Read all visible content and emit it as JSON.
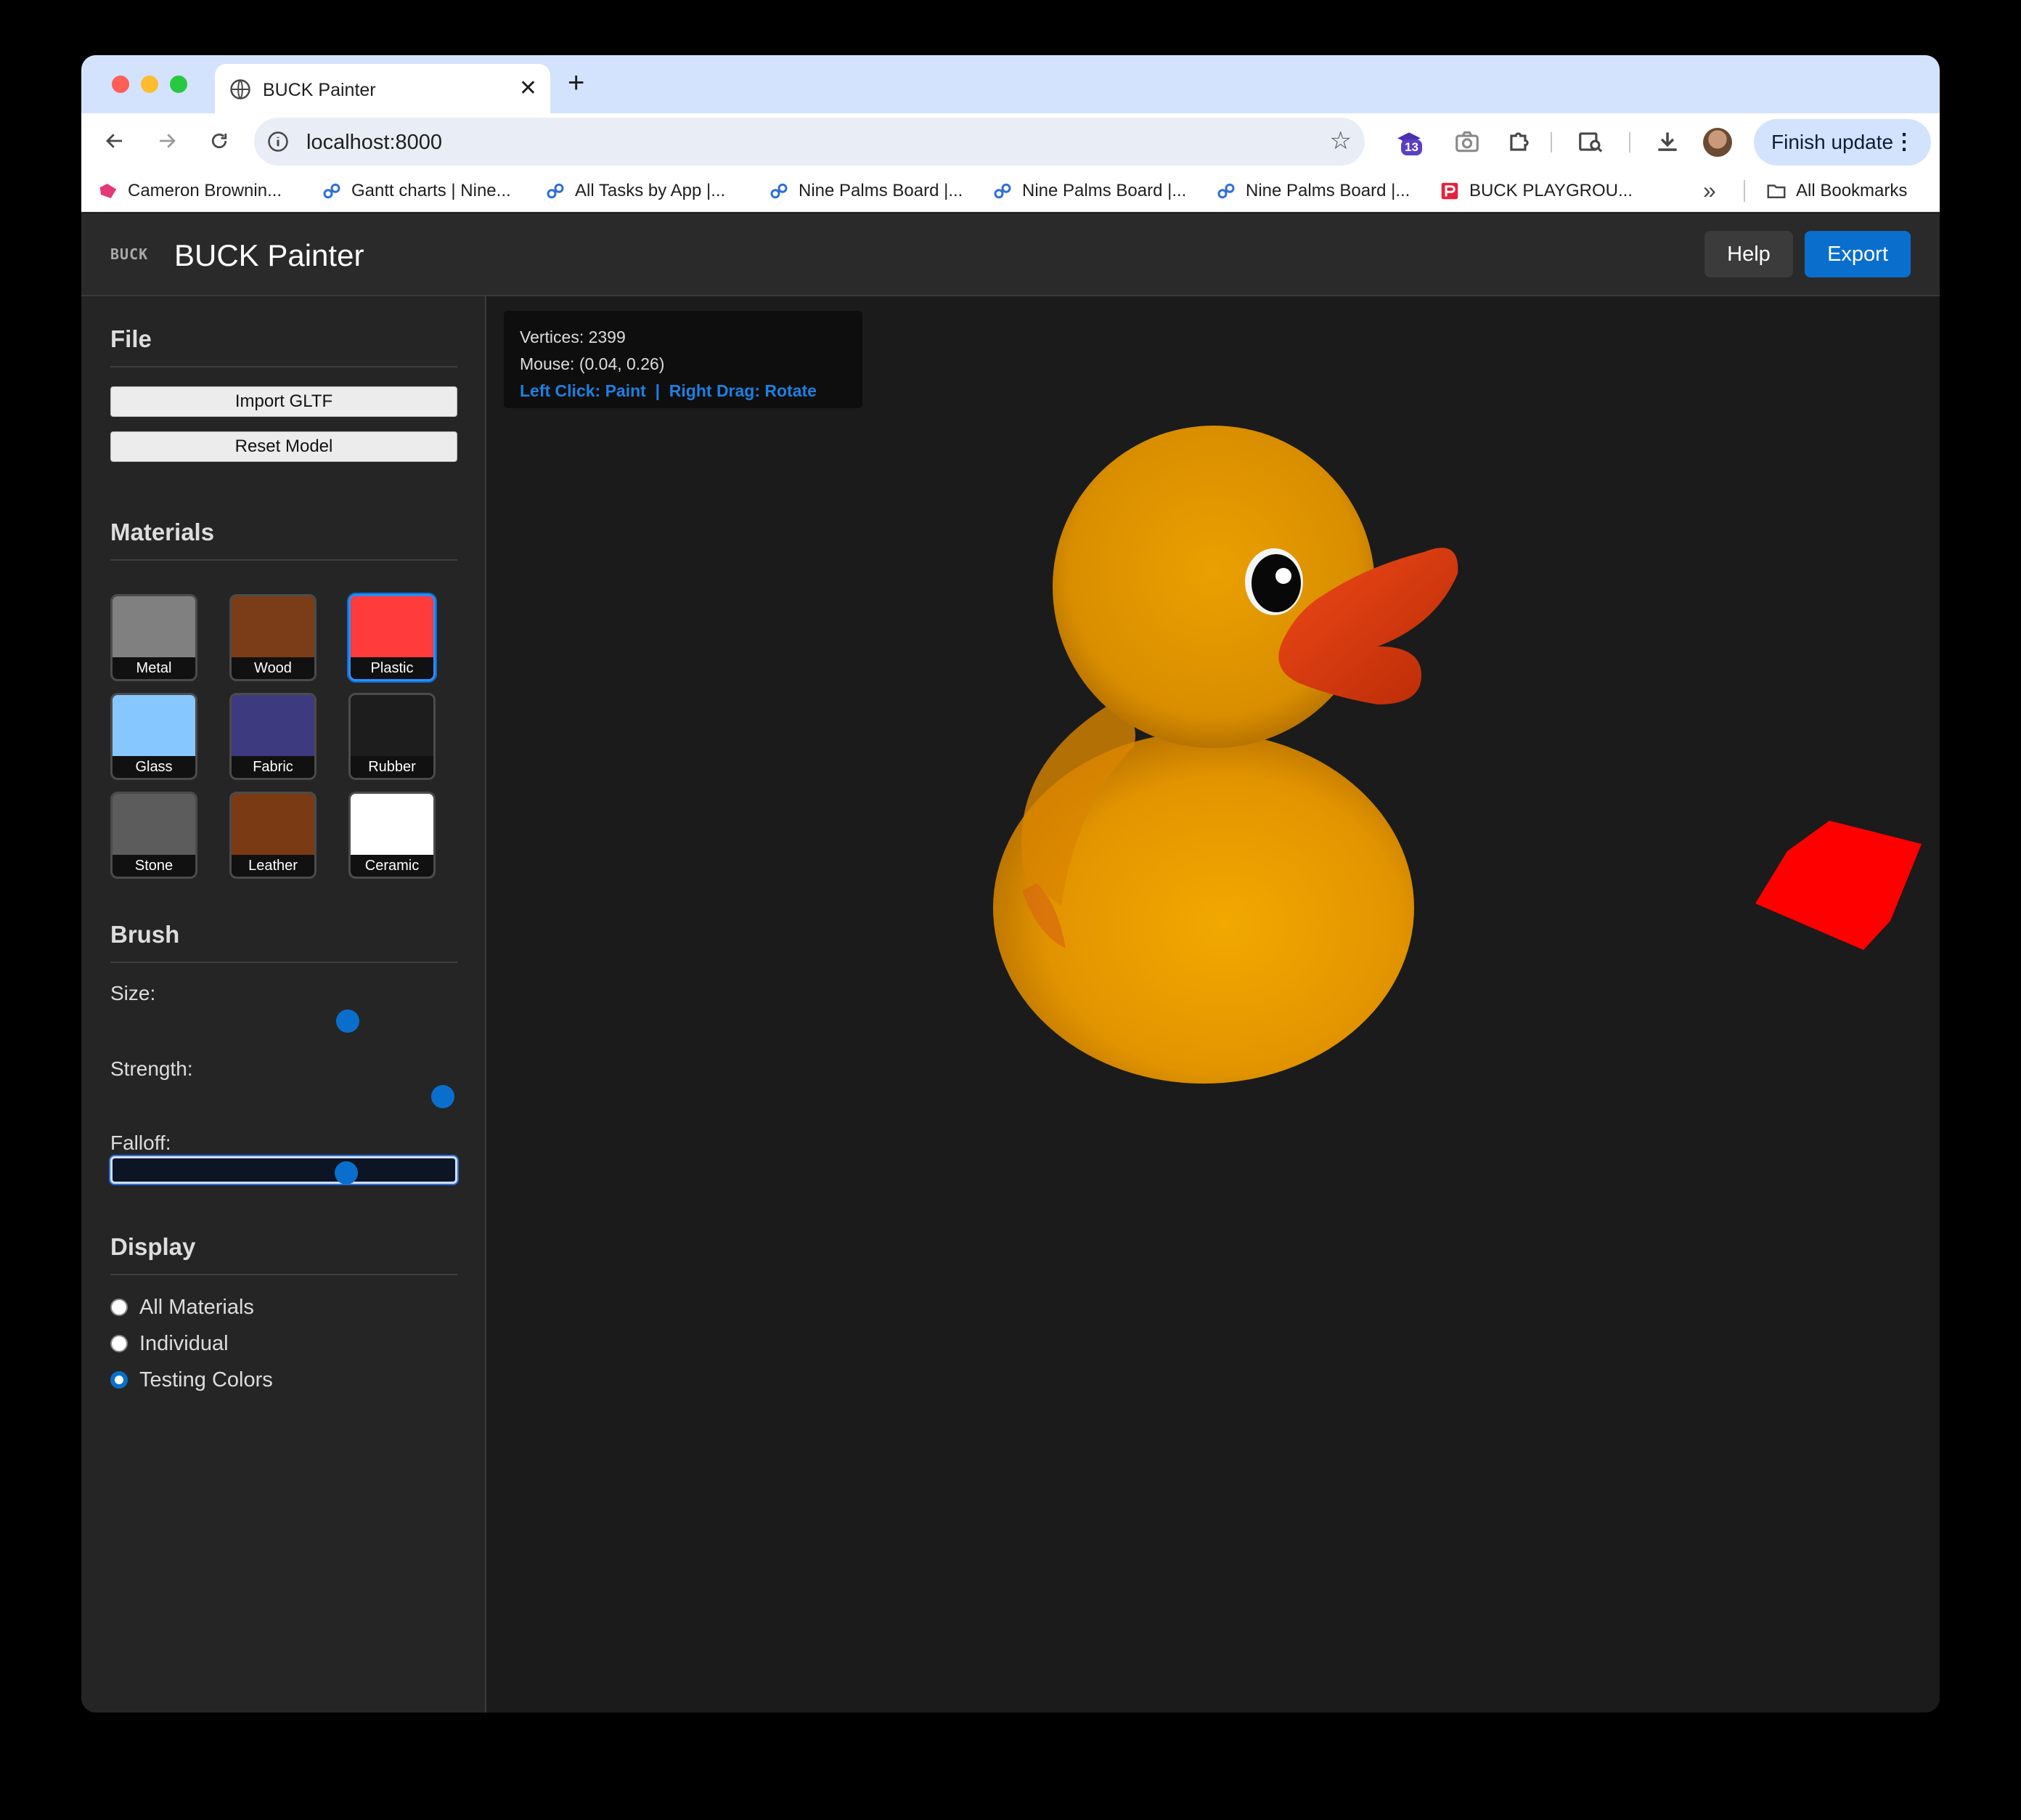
{
  "browser": {
    "tab_title": "BUCK Painter",
    "tab_close": "✕",
    "new_tab": "+",
    "url": "localhost:8000",
    "extension_badge": "13",
    "finish_update": "Finish update",
    "bookmarks": [
      "Cameron Brownin...",
      "Gantt charts | Nine...",
      "All Tasks by App |...",
      "Nine Palms Board |...",
      "Nine Palms Board |...",
      "Nine Palms Board |...",
      "BUCK PLAYGROU..."
    ],
    "bookmarks_overflow": "»",
    "all_bookmarks": "All Bookmarks"
  },
  "app": {
    "logo": "BUCK",
    "title": "BUCK Painter",
    "help_label": "Help",
    "export_label": "Export"
  },
  "sidebar": {
    "file": {
      "title": "File",
      "import_label": "Import GLTF",
      "reset_label": "Reset Model"
    },
    "materials": {
      "title": "Materials",
      "selected": "Plastic",
      "items": [
        {
          "label": "Metal",
          "color": "#808080"
        },
        {
          "label": "Wood",
          "color": "#7a3d18"
        },
        {
          "label": "Plastic",
          "color": "#ff3b3b"
        },
        {
          "label": "Glass",
          "color": "#87c7ff"
        },
        {
          "label": "Fabric",
          "color": "#3e3a80"
        },
        {
          "label": "Rubber",
          "color": "#1d1d1d"
        },
        {
          "label": "Stone",
          "color": "#5c5c5c"
        },
        {
          "label": "Leather",
          "color": "#7a3a14"
        },
        {
          "label": "Ceramic",
          "color": "#ffffff"
        }
      ]
    },
    "brush": {
      "title": "Brush",
      "size_label": "Size:",
      "size_value": 0.7,
      "strength_label": "Strength:",
      "strength_value": 1.0,
      "falloff_label": "Falloff:",
      "falloff_value": 0.7
    },
    "display": {
      "title": "Display",
      "options": [
        "All Materials",
        "Individual",
        "Testing Colors"
      ],
      "selected": "Testing Colors"
    }
  },
  "viewport": {
    "vertices_text": "Vertices: 2399",
    "mouse_text": "Mouse: (0.04, 0.26)",
    "help_text": "Left Click: Paint  |  Right Drag: Rotate",
    "colors": {
      "duck_body": "#e8a000",
      "duck_beak": "#e03a10",
      "cube": "#ff0000"
    }
  }
}
